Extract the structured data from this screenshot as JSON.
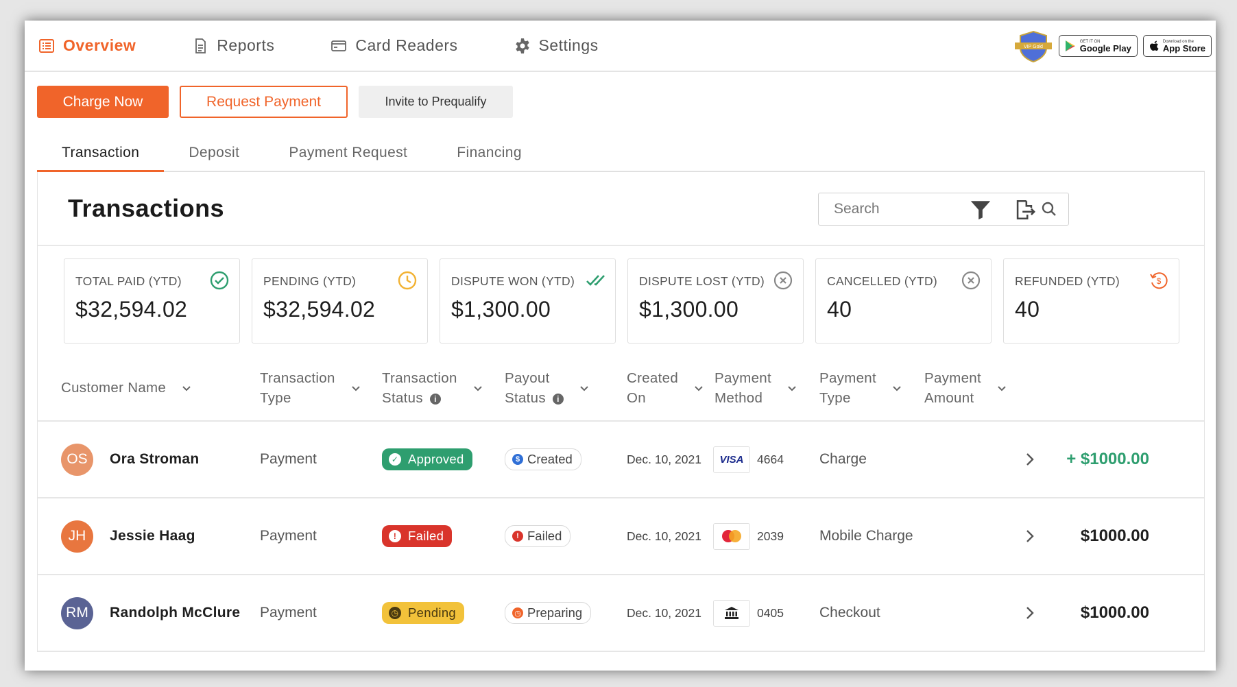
{
  "nav": {
    "items": [
      {
        "label": "Overview",
        "icon": "list-icon",
        "active": true
      },
      {
        "label": "Reports",
        "icon": "document-icon",
        "active": false
      },
      {
        "label": "Card Readers",
        "icon": "card-reader-icon",
        "active": false
      },
      {
        "label": "Settings",
        "icon": "gear-icon",
        "active": false
      }
    ],
    "badges": {
      "vip": "VIP Gold",
      "google_small": "GET IT ON",
      "google_big": "Google Play",
      "apple_small": "Download on the",
      "apple_big": "App Store"
    }
  },
  "actions": {
    "charge_now": "Charge Now",
    "request_payment": "Request Payment",
    "invite": "Invite to Prequalify"
  },
  "tabs": [
    "Transaction",
    "Deposit",
    "Payment Request",
    "Financing"
  ],
  "card": {
    "title": "Transactions",
    "search_placeholder": "Search"
  },
  "stats": [
    {
      "label": "TOTAL PAID (YTD)",
      "value": "$32,594.02",
      "icon": "check-circle-icon",
      "color": "#2e9e6f"
    },
    {
      "label": "PENDING (YTD)",
      "value": "$32,594.02",
      "icon": "clock-icon",
      "color": "#f2b233"
    },
    {
      "label": "DISPUTE WON (YTD)",
      "value": "$1,300.00",
      "icon": "double-check-icon",
      "color": "#2e9e6f"
    },
    {
      "label": "DISPUTE LOST (YTD)",
      "value": "$1,300.00",
      "icon": "x-circle-icon",
      "color": "#888888"
    },
    {
      "label": "CANCELLED (YTD)",
      "value": "40",
      "icon": "x-circle-icon",
      "color": "#888888"
    },
    {
      "label": "REFUNDED (YTD)",
      "value": "40",
      "icon": "refund-icon",
      "color": "#f0642a"
    }
  ],
  "columns": [
    {
      "line1": "Customer Name",
      "line2": ""
    },
    {
      "line1": "Transaction",
      "line2": "Type"
    },
    {
      "line1": "Transaction",
      "line2": "Status"
    },
    {
      "line1": "Payout",
      "line2": "Status"
    },
    {
      "line1": "Created",
      "line2": "On"
    },
    {
      "line1": "Payment",
      "line2": "Method"
    },
    {
      "line1": "Payment",
      "line2": "Type"
    },
    {
      "line1": "Payment",
      "line2": "Amount"
    }
  ],
  "rows": [
    {
      "initials": "OS",
      "avatar_color": "#e8956a",
      "name": "Ora Stroman",
      "type": "Payment",
      "status": "Approved",
      "status_color": "#2e9e6f",
      "status_symbol": "✓",
      "payout": "Created",
      "payout_color": "#2f6fd6",
      "payout_symbol": "$",
      "date": "Dec. 10, 2021",
      "method": "visa",
      "method_label": "VISA",
      "last4": "4664",
      "ptype": "Charge",
      "amount": "+ $1000.00",
      "positive": true
    },
    {
      "initials": "JH",
      "avatar_color": "#e8763f",
      "name": "Jessie Haag",
      "type": "Payment",
      "status": "Failed",
      "status_color": "#d9342b",
      "status_symbol": "!",
      "payout": "Failed",
      "payout_color": "#d9342b",
      "payout_symbol": "!",
      "date": "Dec. 10, 2021",
      "method": "mastercard",
      "method_label": "",
      "last4": "2039",
      "ptype": "Mobile Charge",
      "amount": "$1000.00",
      "positive": false
    },
    {
      "initials": "RM",
      "avatar_color": "#5a6394",
      "name": "Randolph McClure",
      "type": "Payment",
      "status": "Pending",
      "status_color": "#f2c23a",
      "status_symbol": "◷",
      "payout": "Preparing",
      "payout_color": "#f0642a",
      "payout_symbol": "◷",
      "date": "Dec. 10, 2021",
      "method": "bank",
      "method_label": "",
      "last4": "0405",
      "ptype": "Checkout",
      "amount": "$1000.00",
      "positive": false
    }
  ]
}
